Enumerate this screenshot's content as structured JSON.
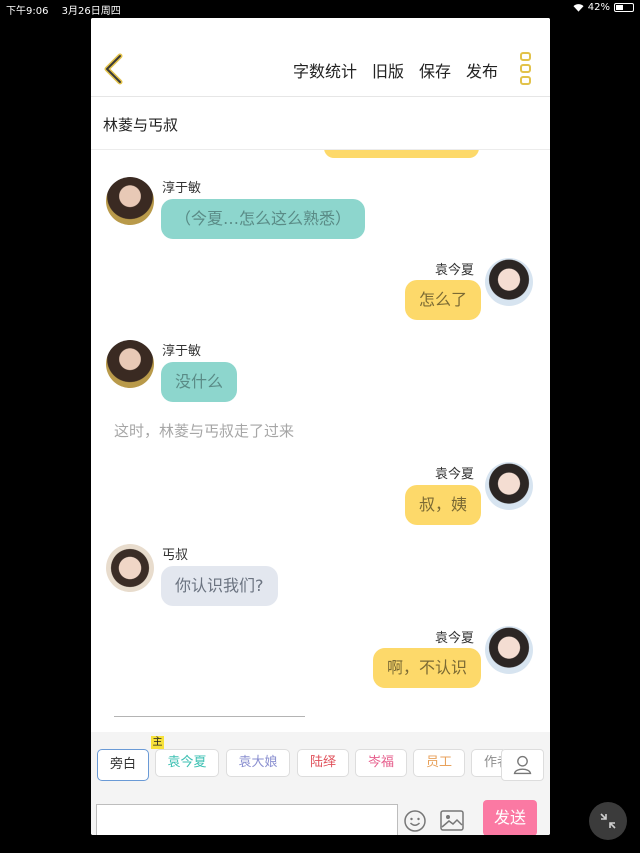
{
  "status_bar": {
    "time": "下午9:06",
    "date": "3月26日周四",
    "battery": "42%",
    "battery_level": 0.42
  },
  "toolbar": {
    "actions": [
      "字数统计",
      "旧版",
      "保存",
      "发布"
    ]
  },
  "chapter_title": "林菱与丐叔",
  "messages": [
    {
      "type": "left",
      "sender": "淳于敏",
      "text": "（今夏…怎么这么熟悉）",
      "color": "teal"
    },
    {
      "type": "right",
      "sender": "袁今夏",
      "text": "怎么了",
      "color": "yellow"
    },
    {
      "type": "left",
      "sender": "淳于敏",
      "text": "没什么",
      "color": "teal"
    },
    {
      "type": "narration",
      "text": "这时，林菱与丐叔走了过来"
    },
    {
      "type": "right",
      "sender": "袁今夏",
      "text": "叔，姨",
      "color": "yellow"
    },
    {
      "type": "left",
      "sender": "丐叔",
      "text": "你认识我们?",
      "color": "grey"
    },
    {
      "type": "right",
      "sender": "袁今夏",
      "text": "啊，不认识",
      "color": "yellow"
    }
  ],
  "characters": [
    {
      "label": "旁白",
      "color": "#333333"
    },
    {
      "label": "袁今夏",
      "color": "#3dc0b3"
    },
    {
      "label": "袁大娘",
      "color": "#8a8fd0"
    },
    {
      "label": "陆绎",
      "color": "#e0505a"
    },
    {
      "label": "岑福",
      "color": "#e65b8a"
    },
    {
      "label": "员工",
      "color": "#e8a25c"
    },
    {
      "label": "作者",
      "color": "#8b8b8b"
    }
  ],
  "main_badge": "主",
  "input": {
    "value": "",
    "placeholder": ""
  },
  "send_label": "发送",
  "colors": {
    "accent": "#e2c24a",
    "send": "#fb79a3",
    "teal_bubble": "#8dd6cd",
    "yellow_bubble": "#fdd96a",
    "grey_bubble": "#e3e7ef"
  }
}
